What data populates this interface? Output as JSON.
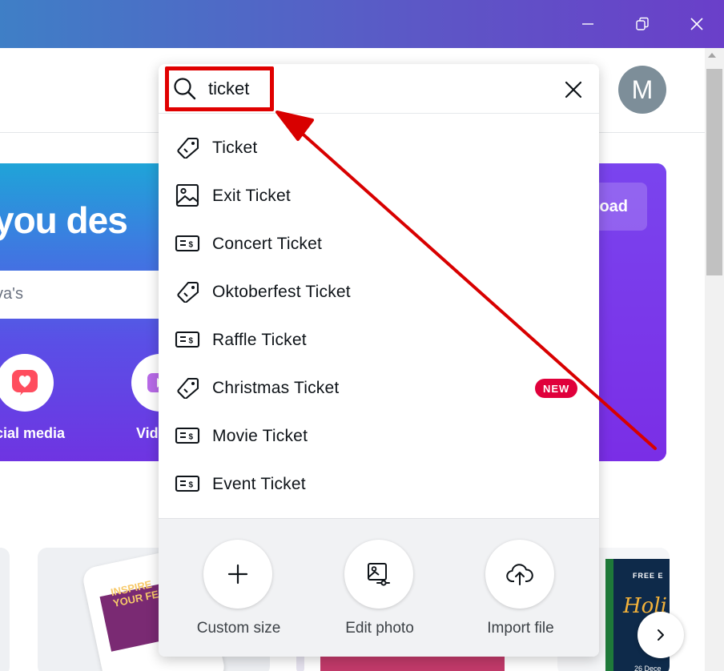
{
  "window": {
    "controls": [
      "minimize-icon",
      "restore-icon",
      "close-icon"
    ]
  },
  "user": {
    "avatar_initial": "M"
  },
  "hero": {
    "headline": "you des",
    "subtitle": "va's",
    "upload_label": "oad",
    "categories": [
      {
        "label": "cial media",
        "icon": "heart-icon"
      },
      {
        "label": "Vid",
        "icon": "video-icon"
      }
    ]
  },
  "search": {
    "value": "ticket",
    "suggestions": [
      {
        "label": "Ticket",
        "icon": "tag-icon"
      },
      {
        "label": "Exit Ticket",
        "icon": "image-icon"
      },
      {
        "label": "Concert Ticket",
        "icon": "ticket-icon"
      },
      {
        "label": "Oktoberfest Ticket",
        "icon": "tag-icon"
      },
      {
        "label": "Raffle Ticket",
        "icon": "ticket-icon"
      },
      {
        "label": "Christmas Ticket",
        "icon": "tag-icon",
        "badge": "NEW"
      },
      {
        "label": "Movie Ticket",
        "icon": "ticket-icon"
      },
      {
        "label": "Event Ticket",
        "icon": "ticket-icon"
      }
    ],
    "quick_actions": [
      {
        "label": "Custom size",
        "icon": "plus-icon"
      },
      {
        "label": "Edit photo",
        "icon": "edit-photo-icon"
      },
      {
        "label": "Import file",
        "icon": "cloud-upload-icon"
      }
    ]
  },
  "thumbnails": {
    "inspire_text": "INSPIRE YOUR FEED",
    "poster_text_top": "FREE E",
    "poster_text_mid": "Holi",
    "poster_text_bottom": "26 Dece"
  },
  "colors": {
    "accent": "#7d2ae8",
    "badge": "#e0003b",
    "annotation": "#e00000"
  }
}
